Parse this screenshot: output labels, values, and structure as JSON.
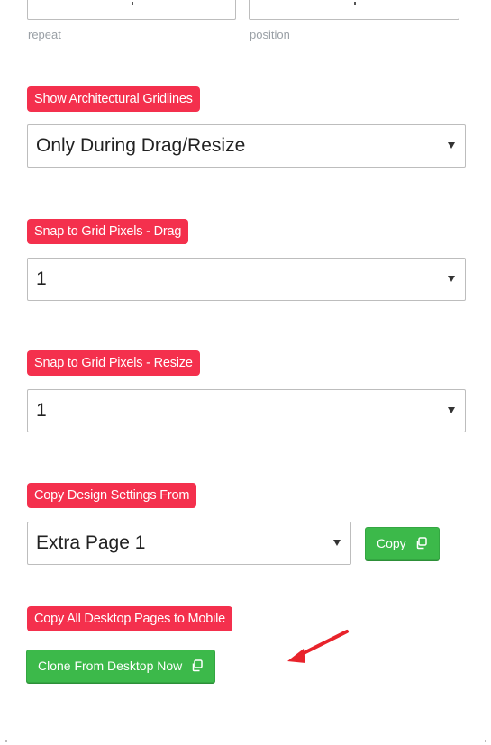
{
  "top_fields": {
    "repeat_label": "repeat",
    "position_label": "position"
  },
  "gridlines": {
    "label": "Show Architectural Gridlines",
    "selected": "Only During Drag/Resize"
  },
  "snap_drag": {
    "label": "Snap to Grid Pixels - Drag",
    "selected": "1"
  },
  "snap_resize": {
    "label": "Snap to Grid Pixels - Resize",
    "selected": "1"
  },
  "copy_design": {
    "label": "Copy Design Settings From",
    "selected": "Extra Page 1",
    "button_label": "Copy"
  },
  "copy_all": {
    "label": "Copy All Desktop Pages to Mobile",
    "button_label": "Clone From Desktop Now"
  },
  "colors": {
    "label_bg": "#f4304d",
    "button_bg": "#3cb94a",
    "annotation_arrow": "#e8232b"
  },
  "icons": {
    "copy": "copy-icon",
    "dropdown": "chevron-down-icon",
    "annotation": "red-arrow-icon"
  }
}
